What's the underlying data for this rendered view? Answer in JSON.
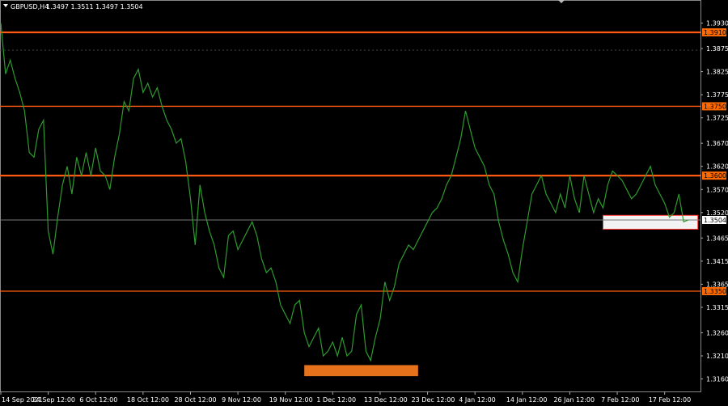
{
  "header": {
    "symbol_timeframe": "GBPUSD,H4",
    "ohlc": "1.3497 1.3511 1.3497 1.3504"
  },
  "colors": {
    "background": "#000000",
    "price_line": "#2e9a2e",
    "level_line": "#ff5a14",
    "level_label_bg": "#ff6a00",
    "demand_zone": "#e6731c",
    "supply_zone": "#ffffff",
    "current_price_label_bg": "#ffffff",
    "grid": "#444444"
  },
  "chart_data": {
    "type": "line",
    "ylim": [
      1.3133,
      1.398
    ],
    "y_ticks": [
      "1.3930",
      "1.3875",
      "1.3825",
      "1.3775",
      "1.3725",
      "1.3670",
      "1.3620",
      "1.3570",
      "1.3520",
      "1.3465",
      "1.3415",
      "1.3365",
      "1.3315",
      "1.3260",
      "1.3210",
      "1.3160"
    ],
    "x_ticks": [
      "14 Sep 2021",
      "24 Sep 12:00",
      "6 Oct 12:00",
      "18 Oct 12:00",
      "28 Oct 12:00",
      "9 Nov 12:00",
      "19 Nov 12:00",
      "1 Dec 12:00",
      "13 Dec 12:00",
      "23 Dec 12:00",
      "4 Jan 12:00",
      "14 Jan 12:00",
      "26 Jan 12:00",
      "7 Feb 12:00",
      "17 Feb 12:00"
    ],
    "x_tick_index": [
      0,
      10,
      20,
      30,
      40,
      50,
      60,
      70,
      80,
      90,
      100,
      110,
      120,
      130,
      140
    ],
    "levels": [
      {
        "label": "1.3910",
        "value": 1.391
      },
      {
        "label": "1.3750",
        "value": 1.375
      },
      {
        "label": "1.3600",
        "value": 1.36
      },
      {
        "label": "1.3350",
        "value": 1.335
      }
    ],
    "current_price": {
      "label": "1.3504",
      "value": 1.3504
    },
    "zones": [
      {
        "from_index": 64,
        "to_index": 88,
        "low": 1.3166,
        "high": 1.319,
        "kind": "demand"
      },
      {
        "from_index": 127,
        "to_index": 147,
        "low": 1.3484,
        "high": 1.3514,
        "kind": "supply"
      }
    ],
    "series": [
      {
        "values": [
          1.393,
          1.382,
          1.385,
          1.381,
          1.378,
          1.374,
          1.365,
          1.364,
          1.37,
          1.372,
          1.348,
          1.343,
          1.351,
          1.358,
          1.362,
          1.356,
          1.364,
          1.36,
          1.365,
          1.36,
          1.366,
          1.361,
          1.36,
          1.357,
          1.364,
          1.369,
          1.376,
          1.374,
          1.381,
          1.383,
          1.378,
          1.38,
          1.377,
          1.379,
          1.375,
          1.372,
          1.37,
          1.367,
          1.368,
          1.363,
          1.355,
          1.345,
          1.358,
          1.352,
          1.348,
          1.345,
          1.34,
          1.338,
          1.347,
          1.348,
          1.344,
          1.346,
          1.348,
          1.35,
          1.347,
          1.342,
          1.339,
          1.34,
          1.337,
          1.332,
          1.33,
          1.328,
          1.332,
          1.333,
          1.326,
          1.323,
          1.325,
          1.327,
          1.321,
          1.322,
          1.324,
          1.321,
          1.325,
          1.321,
          1.322,
          1.33,
          1.332,
          1.322,
          1.32,
          1.325,
          1.329,
          1.337,
          1.333,
          1.336,
          1.341,
          1.343,
          1.345,
          1.344,
          1.346,
          1.348,
          1.35,
          1.352,
          1.353,
          1.355,
          1.358,
          1.36,
          1.364,
          1.368,
          1.374,
          1.37,
          1.366,
          1.364,
          1.362,
          1.358,
          1.356,
          1.35,
          1.346,
          1.343,
          1.339,
          1.337,
          1.344,
          1.35,
          1.356,
          1.358,
          1.36,
          1.356,
          1.354,
          1.352,
          1.356,
          1.353,
          1.36,
          1.355,
          1.352,
          1.36,
          1.356,
          1.352,
          1.355,
          1.353,
          1.358,
          1.361,
          1.36,
          1.359,
          1.357,
          1.355,
          1.356,
          1.358,
          1.36,
          1.362,
          1.358,
          1.356,
          1.354,
          1.351,
          1.352,
          1.356,
          1.35,
          1.3504
        ]
      }
    ]
  }
}
